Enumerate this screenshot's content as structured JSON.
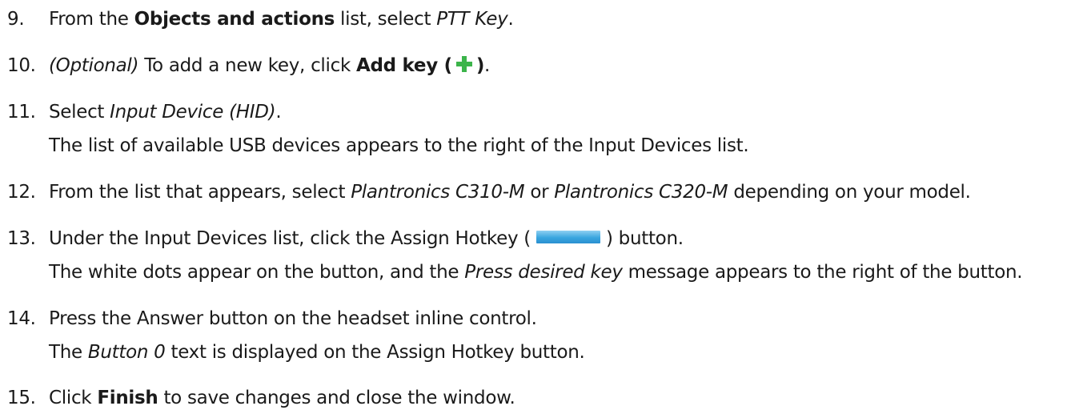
{
  "steps": [
    {
      "num": "9.",
      "segments": {
        "a": "From the ",
        "b": "Objects and actions",
        "c": " list, select ",
        "d": "PTT Key",
        "e": "."
      }
    },
    {
      "num": "10.",
      "segments": {
        "a": "(Optional)",
        "b": " To add a new key, click ",
        "c": "Add key (",
        "d": ")",
        "e": "."
      },
      "icon": "plus-icon",
      "icon_color": "#3cb44a"
    },
    {
      "num": "11.",
      "segments": {
        "a": "Select ",
        "b": "Input Device (HID)",
        "c": "."
      },
      "note": "The list of available USB devices appears to the right of the Input Devices list."
    },
    {
      "num": "12.",
      "segments": {
        "a": "From the list that appears, select ",
        "b": "Plantronics C310-M",
        "c": " or ",
        "d": "Plantronics C320-M",
        "e": " depending on your model."
      }
    },
    {
      "num": "13.",
      "segments": {
        "a": "Under the Input Devices list, click the Assign Hotkey (",
        "b": ") button."
      },
      "icon": "assign-hotkey-button-icon",
      "icon_color": "#3aa6df",
      "note": {
        "a": "The white dots appear on the button, and the ",
        "b": "Press desired key",
        "c": " message appears to the right of the button."
      }
    },
    {
      "num": "14.",
      "text": "Press the Answer button on the headset inline control.",
      "note": {
        "a": "The ",
        "b": "Button 0",
        "c": " text is displayed on the Assign Hotkey button."
      }
    },
    {
      "num": "15.",
      "segments": {
        "a": "Click ",
        "b": "Finish",
        "c": " to save changes and close the window."
      }
    }
  ]
}
